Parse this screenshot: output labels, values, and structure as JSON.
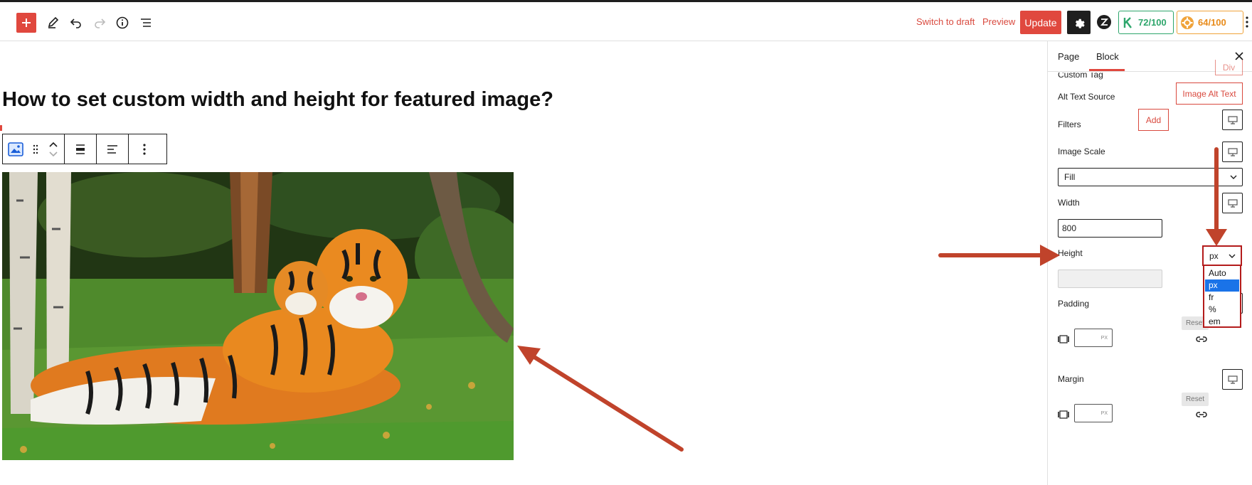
{
  "toolbar": {
    "switch_to_draft": "Switch to draft",
    "preview": "Preview",
    "update": "Update",
    "score_green": "72/100",
    "score_orange": "64/100",
    "accent": "#e0483e"
  },
  "editor": {
    "post_title": "How to set custom width and height for featured image?"
  },
  "sidebar": {
    "tabs": [
      "Page",
      "Block"
    ],
    "custom_tag_label": "Custom Tag",
    "custom_tag_value": "Div",
    "alt_text_source_label": "Alt Text Source",
    "alt_text_source_value": "Image Alt Text",
    "filters_label": "Filters",
    "filters_add": "Add",
    "image_scale_label": "Image Scale",
    "image_scale_value": "Fill",
    "width_label": "Width",
    "width_value": "800",
    "width_unit": "px",
    "unit_options": [
      "Auto",
      "px",
      "fr",
      "%",
      "em"
    ],
    "height_label": "Height",
    "padding_label": "Padding",
    "padding_reset": "Reset",
    "padding_unit": "PX",
    "margin_label": "Margin",
    "margin_reset": "Reset",
    "margin_unit": "PX"
  }
}
